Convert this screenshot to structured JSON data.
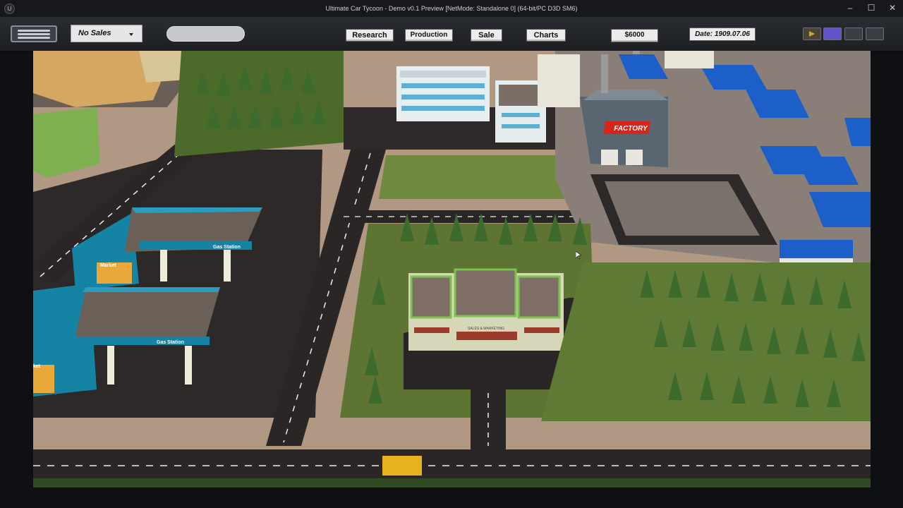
{
  "window": {
    "title": "Ultimate Car Tycoon - Demo v0.1 Preview [NetMode: Standalone 0]  (64-bit/PC D3D SM6)",
    "logo_glyph": "U",
    "controls": {
      "minimize": "–",
      "maximize": "☐",
      "close": "✕"
    }
  },
  "hud": {
    "sales_dropdown": {
      "selected": "No Sales"
    },
    "buttons": {
      "research": "Research",
      "production": "Production",
      "sale": "Sale",
      "charts": "Charts"
    },
    "money": "$6000",
    "date": "Date: 1909.07.06",
    "speed_buttons": [
      "play",
      "speed-1",
      "speed-2",
      "speed-3"
    ]
  },
  "scene": {
    "labels": {
      "factory": "FACTORY",
      "market_top": "Market",
      "gas_station_top": "Gas Station",
      "gas_station_bottom": "Gas Station",
      "market_bottom": "ket",
      "dealership": "SALES & MARKETING"
    },
    "colors": {
      "grass": "#5d7432",
      "asphalt": "#2a2625",
      "pavement": "#b39a83",
      "tree": "#3f6b2e",
      "factory_sign": "#d9241c",
      "warehouse_blue": "#1d5fc9",
      "gas_station_teal": "#1583a3"
    }
  }
}
